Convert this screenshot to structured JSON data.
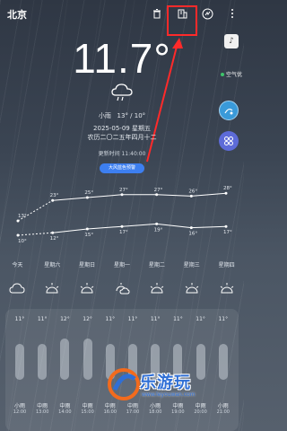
{
  "header": {
    "city": "北京",
    "icons": [
      "trash-icon",
      "add-city-icon",
      "theme-icon",
      "more-icon"
    ]
  },
  "current": {
    "temperature": "11.7°",
    "condition_icon": "cloud-rain-icon",
    "condition": "小雨",
    "range": "13° / 10°",
    "date": "2025-05-09 星期五",
    "lunar": "农历二〇二五年四月十二",
    "updated": "更新时间 11:40:00",
    "alert": "大风蓝色预警"
  },
  "side": {
    "sound": "sound-icon",
    "air_label": "空气优",
    "air_color": "#3ec46b"
  },
  "forecast": {
    "days": [
      "今天",
      "星期六",
      "星期日",
      "星期一",
      "星期二",
      "星期三",
      "星期四"
    ],
    "highs": [
      "",
      "23°",
      "25°",
      "27°",
      "27°",
      "26°",
      "28°"
    ],
    "lows": [
      "10°",
      "12°",
      "15°",
      "17°",
      "19°",
      "16°",
      "17°"
    ],
    "today_high": "13°",
    "icons": [
      "cloud-icon",
      "sun-icon",
      "sun-icon",
      "partly-cloudy-icon",
      "sun-icon",
      "sun-icon",
      "sun-icon"
    ]
  },
  "hourly": [
    {
      "temp": "11°",
      "cond": "小雨",
      "time": "12:00"
    },
    {
      "temp": "11°",
      "cond": "中雨",
      "time": "13:00"
    },
    {
      "temp": "12°",
      "cond": "中雨",
      "time": "14:00"
    },
    {
      "temp": "12°",
      "cond": "中雨",
      "time": "15:00"
    },
    {
      "temp": "11°",
      "cond": "中雨",
      "time": "16:00"
    },
    {
      "temp": "11°",
      "cond": "中雨",
      "time": "17:00"
    },
    {
      "temp": "11°",
      "cond": "小雨",
      "time": "18:00"
    },
    {
      "temp": "11°",
      "cond": "中雨",
      "time": "19:00"
    },
    {
      "temp": "11°",
      "cond": "中雨",
      "time": "20:00"
    },
    {
      "temp": "11°",
      "cond": "小雨",
      "time": "21:00"
    }
  ],
  "watermark": {
    "text": "乐游玩",
    "url": "www.leyouwan.com"
  },
  "colors": {
    "highlight": "#ff2a2a",
    "alert_bg": "#3d7ff0"
  }
}
